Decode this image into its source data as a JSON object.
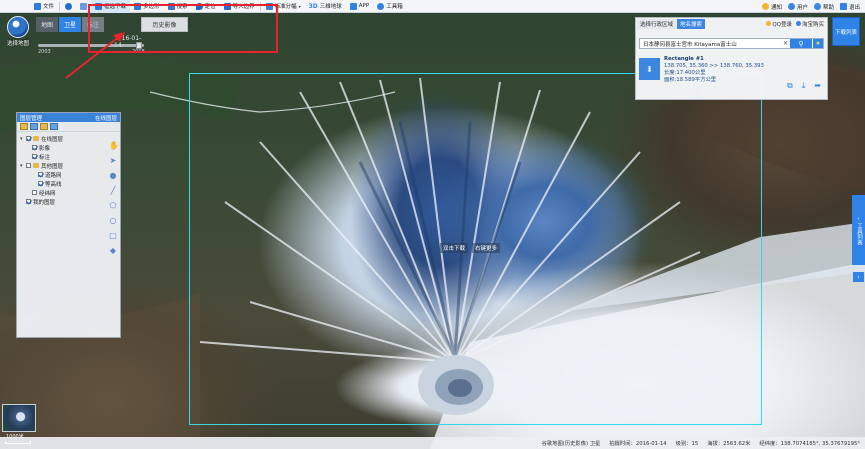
{
  "toolbar": {
    "items": [
      {
        "icon": "file-icon",
        "label": "文件"
      },
      {
        "icon": "search-icon",
        "label": ""
      },
      {
        "icon": "hand-icon",
        "label": ""
      },
      {
        "icon": "frame-select-icon",
        "label": "框选下载"
      },
      {
        "icon": "polygon-icon",
        "label": "多边形"
      },
      {
        "icon": "tag-icon",
        "label": "搜索"
      },
      {
        "icon": "location-pin-icon",
        "label": "定位"
      },
      {
        "icon": "import-icon",
        "label": "导入边界"
      },
      {
        "icon": "grid-icon",
        "label": "标准分幅"
      },
      {
        "icon": "3d-icon",
        "label": "三维地球"
      },
      {
        "icon": "app-icon",
        "label": "APP"
      },
      {
        "icon": "gear-icon",
        "label": "工具箱"
      }
    ],
    "right": [
      {
        "icon": "notice-icon",
        "label": "通知",
        "color": "#f2b233"
      },
      {
        "icon": "user-icon",
        "label": "用户",
        "color": "#3a86e0"
      },
      {
        "icon": "help-icon",
        "label": "帮助",
        "color": "#3a86e0"
      },
      {
        "icon": "exit-icon",
        "label": "退出",
        "color": "#2f82e6"
      }
    ]
  },
  "logo": {
    "text": "选择地图"
  },
  "map_type": {
    "tabs": [
      {
        "label": "地图",
        "state": "normal"
      },
      {
        "label": "卫星",
        "state": "active"
      },
      {
        "label": "标注",
        "state": "dim"
      }
    ],
    "history_label": "历史影像"
  },
  "timeline": {
    "current": "2016-01-14",
    "start_year": "2003",
    "end_year": "2018"
  },
  "layer_panel": {
    "title": "图层管理",
    "action": "在线图层",
    "rows": [
      {
        "indent": 0,
        "caret": "▾",
        "checked": true,
        "folder": true,
        "label": "在线图层"
      },
      {
        "indent": 1,
        "caret": "",
        "checked": true,
        "folder": false,
        "label": "影像"
      },
      {
        "indent": 1,
        "caret": "",
        "checked": true,
        "folder": false,
        "label": "标注"
      },
      {
        "indent": 0,
        "caret": "▾",
        "checked": false,
        "folder": true,
        "label": "其他图层"
      },
      {
        "indent": 2,
        "caret": "",
        "checked": true,
        "folder": false,
        "label": "道路网"
      },
      {
        "indent": 2,
        "caret": "",
        "checked": true,
        "folder": false,
        "label": "等高线"
      },
      {
        "indent": 1,
        "caret": "",
        "checked": false,
        "folder": false,
        "label": "经纬网"
      },
      {
        "indent": 0,
        "caret": "",
        "checked": true,
        "folder": false,
        "label": "我的图层"
      }
    ]
  },
  "draw_tools": [
    "hand-tool-icon",
    "cursor-tool-icon",
    "marker-tool-icon",
    "line-tool-icon",
    "polygon-tool-icon",
    "circle-tool-icon",
    "rectangle-tool-icon",
    "eraser-tool-icon"
  ],
  "map": {
    "dblclick_hint_1": "双击下载",
    "dblclick_hint_2": "右键更多"
  },
  "search_panel": {
    "tabs": [
      {
        "label": "选择行政区域",
        "active": false
      },
      {
        "label": "地名搜索",
        "active": true
      }
    ],
    "links": [
      {
        "label": "QQ登录",
        "color": "#f2b233"
      },
      {
        "label": "淘宝购买",
        "color": "#2f82e6"
      }
    ],
    "query": "日本静冈县富士宫市 Kitayama富士山",
    "result": {
      "title": "Rectangle #1",
      "coords": "138.705, 35.360 >> 138.760, 35.393",
      "width": "长度:17.400公里",
      "area": "面积:18.589平方公里"
    }
  },
  "download_button": {
    "label": "下载列表"
  },
  "side_tab": {
    "label": "工具列表"
  },
  "scale": {
    "label": "1000米"
  },
  "status": {
    "source": "谷歌地图(历史影像) 卫星",
    "date": "拍摄时间：2016-01-14",
    "level": "级别：15",
    "altitude": "海拔：2563.62米",
    "coords": "经纬度：138.7074185°, 35.37679195°"
  },
  "colors": {
    "accent": "#2f82e6",
    "annotation_red": "#e8232d",
    "selection_cyan": "#34d8e8"
  }
}
